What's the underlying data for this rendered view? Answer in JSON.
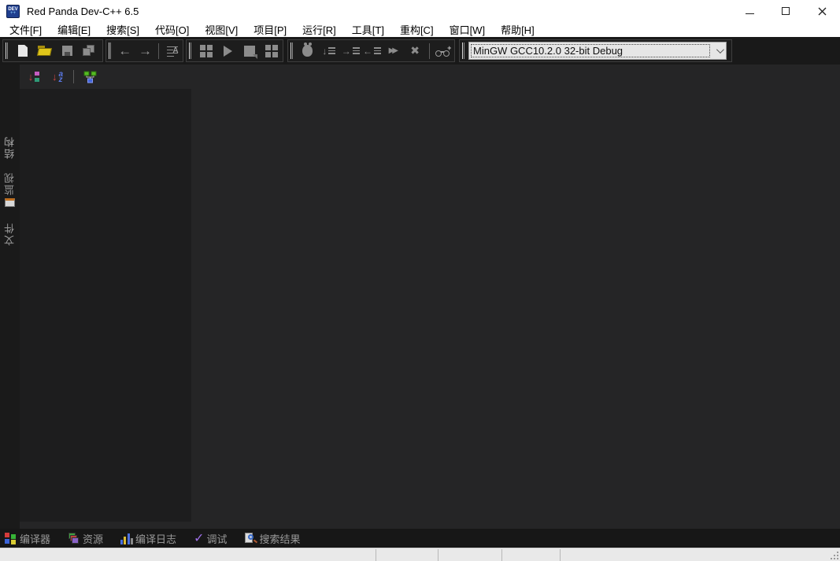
{
  "window": {
    "title": "Red Panda Dev-C++ 6.5",
    "icon_text": "DEV",
    "icon_plus": "++",
    "controls": [
      {
        "icon": "minimize-icon"
      },
      {
        "icon": "maximize-icon"
      },
      {
        "icon": "close-icon"
      }
    ]
  },
  "menu_bar": {
    "items": [
      {
        "label": "文件[F]"
      },
      {
        "label": "编辑[E]"
      },
      {
        "label": "搜索[S]"
      },
      {
        "label": "代码[O]"
      },
      {
        "label": "视图[V]"
      },
      {
        "label": "项目[P]"
      },
      {
        "label": "运行[R]"
      },
      {
        "label": "工具[T]"
      },
      {
        "label": "重构[C]"
      },
      {
        "label": "窗口[W]"
      },
      {
        "label": "帮助[H]"
      }
    ]
  },
  "toolbar": {
    "file_group": [
      {
        "icon": "new-file-icon",
        "disabled": false
      },
      {
        "icon": "open-folder-icon",
        "disabled": false
      },
      {
        "icon": "save-icon",
        "disabled": true
      },
      {
        "icon": "save-all-icon",
        "disabled": true
      }
    ],
    "nav_group": [
      {
        "icon": "back-arrow-icon"
      },
      {
        "icon": "forward-arrow-icon"
      },
      {
        "icon": "reformat-code-icon"
      }
    ],
    "build_group": [
      {
        "icon": "compile-icon",
        "disabled": true
      },
      {
        "icon": "run-icon",
        "disabled": true
      },
      {
        "icon": "rebuild-icon",
        "disabled": true
      },
      {
        "icon": "compile-run-icon",
        "disabled": true
      }
    ],
    "debug_group": [
      {
        "icon": "debug-bug-icon",
        "disabled": true
      },
      {
        "icon": "step-over-icon",
        "disabled": true
      },
      {
        "icon": "step-into-icon",
        "disabled": true
      },
      {
        "icon": "step-out-icon",
        "disabled": true
      },
      {
        "icon": "continue-icon",
        "disabled": true
      },
      {
        "icon": "stop-icon",
        "disabled": true
      },
      {
        "icon": "add-watch-icon",
        "disabled": false
      }
    ],
    "compiler_set": {
      "value": "MinGW GCC10.2.0 32-bit Debug",
      "chevron": "chevron-down-icon"
    }
  },
  "glyphs": {
    "back": "←",
    "forward": "→",
    "continue": "▶▶",
    "stop": "✖",
    "step_over": "↓",
    "step_into": "→",
    "step_out": "←",
    "sort_arrow": "↓",
    "alpha_a": "a",
    "alpha_z": "z",
    "check": "✓",
    "reformat_a": "A",
    "watch_plus": "+"
  },
  "sidebar": {
    "tabs": [
      {
        "label": "结构",
        "selected": true
      },
      {
        "label": "监视",
        "icon": "watch-window-icon",
        "selected": false
      },
      {
        "label": "文件",
        "selected": false
      }
    ]
  },
  "structure_header": {
    "buttons": [
      {
        "icon": "sort-by-type-icon"
      },
      {
        "icon": "sort-alpha-icon"
      },
      {
        "icon": "class-hierarchy-icon"
      }
    ]
  },
  "bottom_tabs": {
    "items": [
      {
        "label": "编译器",
        "icon": "compiler-tab-icon"
      },
      {
        "label": "资源",
        "icon": "resources-tab-icon"
      },
      {
        "label": "编译日志",
        "icon": "compile-log-tab-icon"
      },
      {
        "label": "调试",
        "icon": "debug-tab-icon"
      },
      {
        "label": "搜索结果",
        "icon": "search-results-tab-icon"
      }
    ]
  },
  "status_bar": {
    "sections": [
      "",
      "",
      "",
      "",
      ""
    ],
    "grip_icon": "resize-grip-icon"
  },
  "colors": {
    "titlebar_bg": "#ffffff",
    "menubar_bg": "#ffffff",
    "toolbar_bg": "#191919",
    "main_bg": "#252526",
    "panel_bg": "#1d1d1e",
    "tabstrip_bg": "#1a1a1a",
    "bottombar_bg": "#171717",
    "statusbar_bg": "#e9e9e9",
    "folder_yellow": "#e0c61a",
    "disabled_icon_gray": "#8c8c8c",
    "sort_arrow_red": "#cc4444",
    "alpha_blue": "#5b79e8",
    "node_green": "#55bb22",
    "node_blue": "#4466dd",
    "check_purple": "#9c6ee6"
  }
}
